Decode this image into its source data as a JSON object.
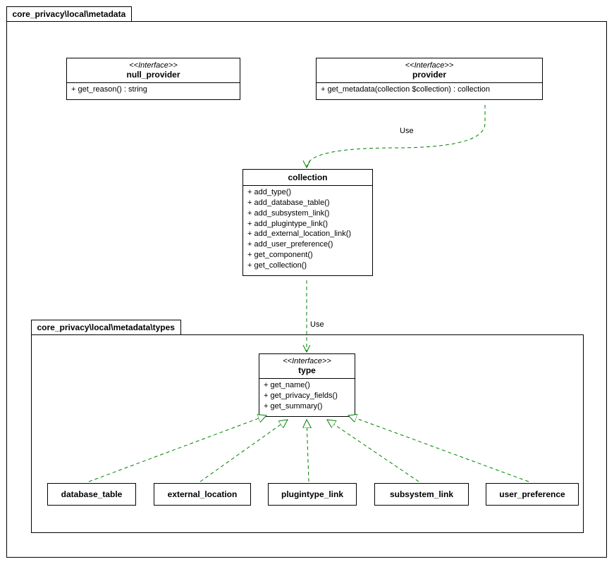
{
  "packages": {
    "outer": "core_privacy\\local\\metadata",
    "inner": "core_privacy\\local\\metadata\\types"
  },
  "null_provider": {
    "stereo": "<<Interface>>",
    "name": "null_provider",
    "m0": "+ get_reason() : string"
  },
  "provider": {
    "stereo": "<<Interface>>",
    "name": "provider",
    "m0": "+ get_metadata(collection $collection) : collection"
  },
  "collection": {
    "name": "collection",
    "m0": "+ add_type()",
    "m1": "+ add_database_table()",
    "m2": "+ add_subsystem_link()",
    "m3": "+ add_plugintype_link()",
    "m4": "+ add_external_location_link()",
    "m5": "+ add_user_preference()",
    "m6": "+ get_component()",
    "m7": "+ get_collection()"
  },
  "type": {
    "stereo": "<<Interface>>",
    "name": "type",
    "m0": "+ get_name()",
    "m1": "+ get_privacy_fields()",
    "m2": "+ get_summary()"
  },
  "leaf": {
    "l0": "database_table",
    "l1": "external_location",
    "l2": "plugintype_link",
    "l3": "subsystem_link",
    "l4": "user_preference"
  },
  "rel": {
    "use": "Use"
  },
  "chart_data": {
    "type": "uml-class-diagram",
    "packages": [
      {
        "name": "core_privacy\\local\\metadata",
        "contains": [
          "null_provider",
          "provider",
          "collection",
          "core_privacy\\local\\metadata\\types"
        ]
      },
      {
        "name": "core_privacy\\local\\metadata\\types",
        "contains": [
          "type",
          "database_table",
          "external_location",
          "plugintype_link",
          "subsystem_link",
          "user_preference"
        ]
      }
    ],
    "interfaces": [
      {
        "name": "null_provider",
        "methods": [
          "get_reason() : string"
        ]
      },
      {
        "name": "provider",
        "methods": [
          "get_metadata(collection $collection) : collection"
        ]
      },
      {
        "name": "type",
        "methods": [
          "get_name()",
          "get_privacy_fields()",
          "get_summary()"
        ]
      }
    ],
    "classes": [
      {
        "name": "collection",
        "methods": [
          "add_type()",
          "add_database_table()",
          "add_subsystem_link()",
          "add_plugintype_link()",
          "add_external_location_link()",
          "add_user_preference()",
          "get_component()",
          "get_collection()"
        ]
      },
      {
        "name": "database_table"
      },
      {
        "name": "external_location"
      },
      {
        "name": "plugintype_link"
      },
      {
        "name": "subsystem_link"
      },
      {
        "name": "user_preference"
      }
    ],
    "relations": [
      {
        "from": "provider",
        "to": "collection",
        "kind": "dependency",
        "label": "Use"
      },
      {
        "from": "collection",
        "to": "type",
        "kind": "dependency",
        "label": "Use"
      },
      {
        "from": "database_table",
        "to": "type",
        "kind": "realization"
      },
      {
        "from": "external_location",
        "to": "type",
        "kind": "realization"
      },
      {
        "from": "plugintype_link",
        "to": "type",
        "kind": "realization"
      },
      {
        "from": "subsystem_link",
        "to": "type",
        "kind": "realization"
      },
      {
        "from": "user_preference",
        "to": "type",
        "kind": "realization"
      }
    ]
  }
}
